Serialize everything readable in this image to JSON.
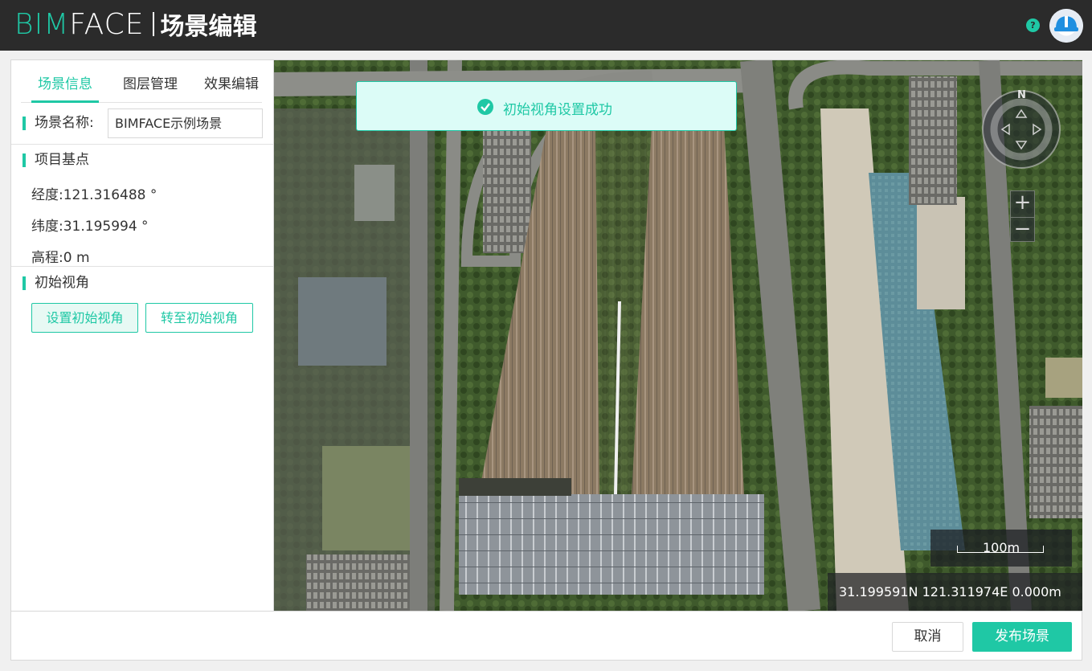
{
  "header": {
    "logo_bim": "BIM",
    "logo_face": "FACE",
    "title": "场景编辑",
    "help_label": "?"
  },
  "tabs": [
    {
      "label": "场景信息",
      "active": true
    },
    {
      "label": "图层管理",
      "active": false
    },
    {
      "label": "效果编辑",
      "active": false
    }
  ],
  "scene": {
    "name_label": "场景名称:",
    "name_value": "BIMFACE示例场景"
  },
  "base_point": {
    "title": "项目基点",
    "longitude": "经度:121.316488 °",
    "latitude": "纬度:31.195994 °",
    "elevation": "高程:0 m"
  },
  "initial_view": {
    "title": "初始视角",
    "set_label": "设置初始视角",
    "goto_label": "转至初始视角"
  },
  "map": {
    "toast": "初始视角设置成功",
    "compass_north": "N",
    "zoom_in": "+",
    "zoom_out": "−",
    "scale": "100m",
    "coords": "31.199591N  121.311974E  0.000m"
  },
  "footer": {
    "cancel_label": "取消",
    "publish_label": "发布场景"
  },
  "colors": {
    "accent": "#1fc8a5",
    "header_bg": "#2b2b2b",
    "toast_bg": "#dcfcf7"
  }
}
